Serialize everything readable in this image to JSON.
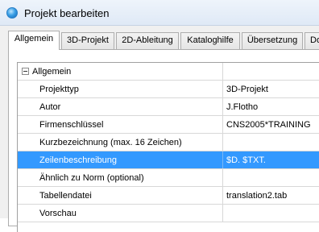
{
  "window": {
    "title": "Projekt bearbeiten",
    "icon": "app-icon"
  },
  "tabs": [
    {
      "label": "Allgemein",
      "active": true
    },
    {
      "label": "3D-Projekt",
      "active": false
    },
    {
      "label": "2D-Ableitung",
      "active": false
    },
    {
      "label": "Kataloghilfe",
      "active": false
    },
    {
      "label": "Übersetzung",
      "active": false
    },
    {
      "label": "Doku",
      "active": false
    }
  ],
  "grid": {
    "group": {
      "label": "Allgemein",
      "expander_icon": "collapse-minus-icon"
    },
    "rows": [
      {
        "label": "Projekttyp",
        "value": "3D-Projekt"
      },
      {
        "label": "Autor",
        "value": "J.Flotho"
      },
      {
        "label": "Firmenschlüssel",
        "value": "CNS2005*TRAINING"
      },
      {
        "label": "Kurzbezeichnung (max. 16 Zeichen)",
        "value": ""
      },
      {
        "label": "Zeilenbeschreibung",
        "value": "$D. $TXT.",
        "selected": true
      },
      {
        "label": "Ähnlich zu Norm (optional)",
        "value": ""
      },
      {
        "label": "Tabellendatei",
        "value": "translation2.tab"
      },
      {
        "label": "Vorschau",
        "value": ""
      }
    ]
  },
  "colors": {
    "selection": "#3399ff",
    "title_bar": "#dfe9f6"
  }
}
